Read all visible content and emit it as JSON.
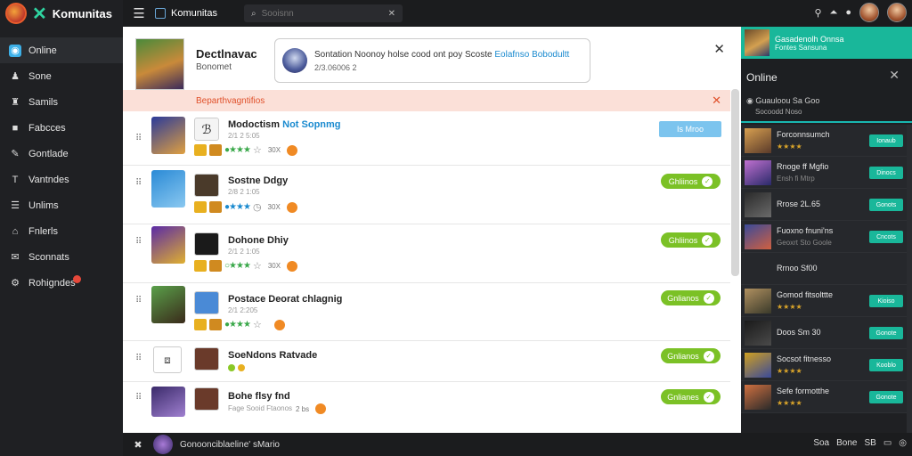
{
  "app": {
    "name": "Komunitas",
    "window_title": "Komunitas"
  },
  "sidebar": {
    "items": [
      {
        "label": "Online",
        "icon": "globe-icon",
        "glyph": "◉"
      },
      {
        "label": "Sone",
        "icon": "user-icon",
        "glyph": "♟"
      },
      {
        "label": "Samils",
        "icon": "person-icon",
        "glyph": "♜"
      },
      {
        "label": "Fabcces",
        "icon": "box-icon",
        "glyph": "■"
      },
      {
        "label": "Gontlade",
        "icon": "pin-icon",
        "glyph": "✎"
      },
      {
        "label": "Vantndes",
        "icon": "text-icon",
        "glyph": "T"
      },
      {
        "label": "Unlims",
        "icon": "list-icon",
        "glyph": "☰"
      },
      {
        "label": "Fnlerls",
        "icon": "home-icon",
        "glyph": "⌂"
      },
      {
        "label": "Sconnats",
        "icon": "link-icon",
        "glyph": "✉"
      },
      {
        "label": "Rohigndes",
        "icon": "gear-icon",
        "glyph": "⚙"
      }
    ]
  },
  "topbar": {
    "app_label": "Komunitas",
    "search_placeholder": "Sooisnn"
  },
  "header": {
    "title": "Dectlnavac",
    "subtitle": "Bonomet",
    "notification": {
      "text": "Sontation Noonoy holse cood ont poy Scoste",
      "highlight": "Eolafnso Bobodultt",
      "meta": "2/3.06006  2"
    }
  },
  "alert": {
    "text": "Beparthvagntifios"
  },
  "rows": [
    {
      "title": "Modoctism",
      "highlight": "Not Sopnmg",
      "meta": "2/1 2 5:05",
      "count": "30X",
      "action": "Is Mroo",
      "action_type": "blue",
      "thumb_colors": [
        "#2a3a9a",
        "#e0a040"
      ],
      "mini": "#f4f4f4"
    },
    {
      "title": "Sostne Ddgy",
      "highlight": "",
      "meta": "2/8 2 1:05",
      "count": "30X",
      "action": "Ghliinos",
      "action_type": "green",
      "thumb_colors": [
        "#2a8ad6",
        "#8ac8f0"
      ],
      "mini": "#4a3a2a"
    },
    {
      "title": "Dohone Dhiy",
      "highlight": "",
      "meta": "2/1 2 1:05",
      "count": "30X",
      "action": "Ghliinos",
      "action_type": "green",
      "thumb_colors": [
        "#5a2aa6",
        "#e0b030"
      ],
      "mini": "#1a1a1a"
    },
    {
      "title": "Postace Deorat chlagnig",
      "highlight": "",
      "meta": "2/1 2:205",
      "count": "",
      "action": "Gnlianos",
      "action_type": "green",
      "thumb_colors": [
        "#5aa04a",
        "#3a2a1a"
      ],
      "mini": "#4a8ad6"
    },
    {
      "title": "SoeNdons Ratvade",
      "highlight": "",
      "meta": "",
      "count": "",
      "action": "Gnlianos",
      "action_type": "green",
      "thumb_colors": [
        "#ffffff",
        "#cccccc"
      ],
      "mini": "#6a3a2a"
    },
    {
      "title": "Bohe flsy fnd",
      "highlight": "",
      "meta": "Fage Sooid  Ftaonos",
      "count": "2 bs",
      "action": "Gnlianes",
      "action_type": "green",
      "thumb_colors": [
        "#3a2a6a",
        "#a080d0"
      ],
      "mini": "#6a3a2a"
    }
  ],
  "right_panel": {
    "top_line1": "Gasadenolh Onnsa",
    "top_line2": "Fontes Sansuna",
    "title": "Online",
    "status1": "Guauloou Sa Goo",
    "status2": "Socoodd Noso",
    "users": [
      {
        "name": "Forconnsumch",
        "stars": "★★★★",
        "gray": false,
        "btn": "Ionaub",
        "pic": [
          "#d8a050",
          "#5a3a2a"
        ]
      },
      {
        "name": "Rnoge ff Mgfio",
        "stars": "Ensh fi Mtrp",
        "gray": true,
        "btn": "Dinocs",
        "pic": [
          "#c070d0",
          "#2a2a6a"
        ]
      },
      {
        "name": "Rrose 2L.65",
        "stars": "",
        "gray": false,
        "btn": "Gonots",
        "pic": [
          "#2a2a2a",
          "#6a6a6a"
        ]
      },
      {
        "name": "Fuoxno fnuni'ns",
        "stars": "Geoxrt Sto Goole",
        "gray": true,
        "btn": "Cncots",
        "pic": [
          "#3a4a9a",
          "#d06040"
        ]
      },
      {
        "name": "Rrnoo Sf00",
        "stars": "",
        "gray": false,
        "btn": "",
        "pic": []
      },
      {
        "name": "Gomod fitsolttte",
        "stars": "★★★★",
        "gray": false,
        "btn": "Kioiso",
        "pic": [
          "#b09060",
          "#3a3a2a"
        ]
      },
      {
        "name": "Doos Sm 30",
        "stars": "",
        "gray": false,
        "btn": "Gonote",
        "pic": [
          "#1a1a1a",
          "#4a4a4a"
        ]
      },
      {
        "name": "Socsot fitnesso",
        "stars": "★★★★",
        "gray": false,
        "btn": "Kooblo",
        "pic": [
          "#d0a020",
          "#3a4a9a"
        ]
      },
      {
        "name": "Sefe formotthe",
        "stars": "★★★★",
        "gray": false,
        "btn": "Gonote",
        "pic": [
          "#d07040",
          "#2a2a2a"
        ]
      }
    ]
  },
  "bottom": {
    "text": "Gonoonciblaeline' sMario",
    "right1": "Soa",
    "right2": "Bone",
    "right3": "SB"
  },
  "colors": {
    "accent_green": "#7bc126",
    "teal": "#19b79a",
    "alert_bg": "#fbe0d8",
    "alert_text": "#e0502a",
    "link_blue": "#1a8acf"
  }
}
